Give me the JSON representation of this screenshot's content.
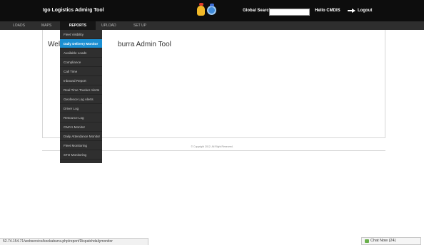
{
  "header": {
    "app_title": "Igo Logistics Admirg Tool",
    "search_label": "Global Search",
    "search_value": "",
    "hello_text": "Hello CMDIS",
    "logout_label": "Logout"
  },
  "nav": {
    "items": [
      "LOADS",
      "MAPS",
      "REPORTS",
      "UPLOAD",
      "SET UP"
    ],
    "active": "REPORTS"
  },
  "dropdown": {
    "items": [
      "Fleet Visibility",
      "Daily Delivery Monitor",
      "Available Loads",
      "Compliance",
      "Call Time",
      "Inbound Report",
      "Real Time Tracker Alerts",
      "Geofence Log Alerts",
      "Driver Log",
      "Resource Log",
      "CMA's Monitor",
      "Daily Attendance Monitor",
      "Fleet Monitoring",
      "STO Monitoring"
    ],
    "highlighted": "Daily Delivery Monitor"
  },
  "main": {
    "welcome_left": "Welc",
    "welcome_right": "burra Admin Tool"
  },
  "footer": {
    "copyright": "© Copyright 2012. All Right Reserved."
  },
  "status_bar": {
    "url": "52.74.154.71/webservice/kookaburra.php/report/Dispatchdailymonitor"
  },
  "chat": {
    "label": "Chat Now (24)"
  },
  "colors": {
    "header_bg": "#0d0d0d",
    "nav_bg": "#2e2e2e",
    "dropdown_bg": "#2f2f2f",
    "highlight": "#1b8fd2"
  }
}
